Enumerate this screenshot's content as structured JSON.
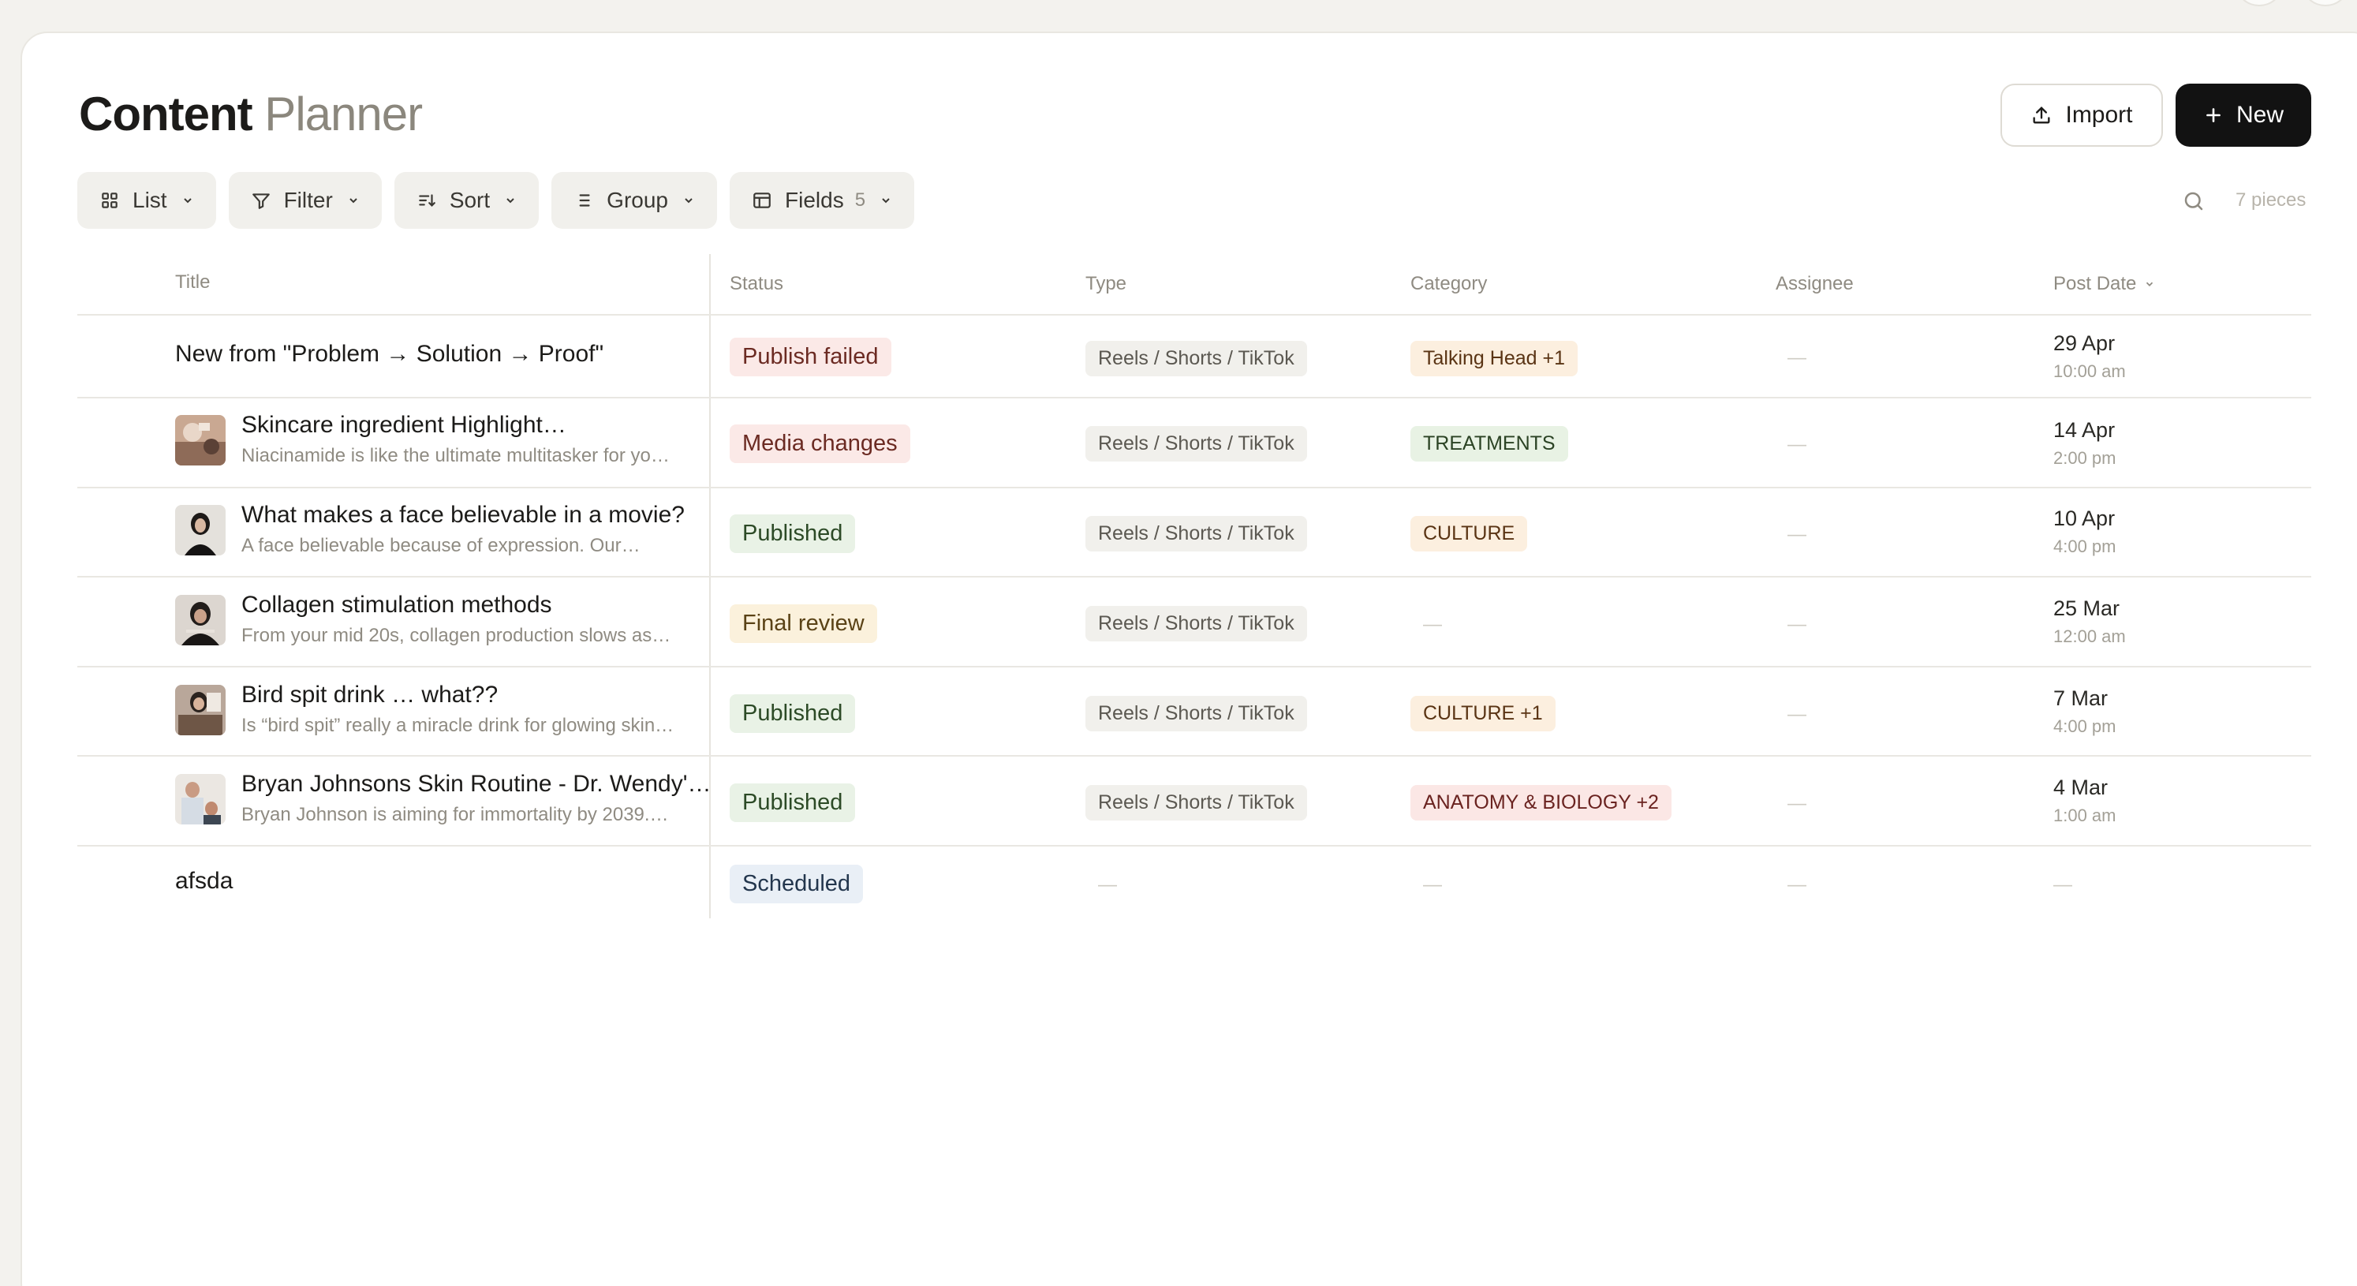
{
  "header": {
    "title_main": "Content",
    "title_secondary": "Planner",
    "import_label": "Import",
    "new_label": "New"
  },
  "toolbar": {
    "view_label": "List",
    "filter_label": "Filter",
    "sort_label": "Sort",
    "group_label": "Group",
    "fields_label": "Fields",
    "fields_count": "5",
    "pieces_label": "7 pieces"
  },
  "columns": {
    "title": "Title",
    "status": "Status",
    "type": "Type",
    "category": "Category",
    "assignee": "Assignee",
    "post_date": "Post Date"
  },
  "empty_placeholder": "—",
  "rows": [
    {
      "title": "New from \"Problem → Solution → Proof\"",
      "subtitle": "",
      "status": "Publish failed",
      "type": "Reels / Shorts / TikTok",
      "category": "Talking Head +1",
      "date": "29 Apr",
      "time": "10:00 am"
    },
    {
      "title": "Skincare ingredient Highlight…",
      "subtitle": "Niacinamide is like the ultimate multitasker for yo…",
      "status": "Media changes",
      "type": "Reels / Shorts / TikTok",
      "category": "TREATMENTS",
      "date": "14 Apr",
      "time": "2:00 pm"
    },
    {
      "title": "What makes a face believable in a movie?",
      "subtitle": "A face believable because of expression. Our…",
      "status": "Published",
      "type": "Reels / Shorts / TikTok",
      "category": "CULTURE",
      "date": "10 Apr",
      "time": "4:00 pm"
    },
    {
      "title": "Collagen stimulation methods",
      "subtitle": "From your mid 20s, collagen production slows as…",
      "status": "Final review",
      "type": "Reels / Shorts / TikTok",
      "category": "",
      "date": "25 Mar",
      "time": "12:00 am"
    },
    {
      "title": "Bird spit drink … what??",
      "subtitle": "Is “bird spit” really a miracle drink for glowing skin…",
      "status": "Published",
      "type": "Reels / Shorts / TikTok",
      "category": "CULTURE +1",
      "date": "7 Mar",
      "time": "4:00 pm"
    },
    {
      "title": "Bryan Johnsons Skin Routine - Dr. Wendy'…",
      "subtitle": "Bryan Johnson is aiming for immortality by 2039.…",
      "status": "Published",
      "type": "Reels / Shorts / TikTok",
      "category": "ANATOMY & BIOLOGY +2",
      "date": "4 Mar",
      "time": "1:00 am"
    },
    {
      "title": "afsda",
      "subtitle": "",
      "status": "Scheduled",
      "type": "",
      "category": "",
      "date": "",
      "time": ""
    }
  ],
  "colors": {
    "accent_dark": "#121212",
    "status_failed": "#fbe9e7",
    "status_published": "#e9f2e6",
    "status_review": "#fbf1dc",
    "status_scheduled": "#e9eff6"
  }
}
